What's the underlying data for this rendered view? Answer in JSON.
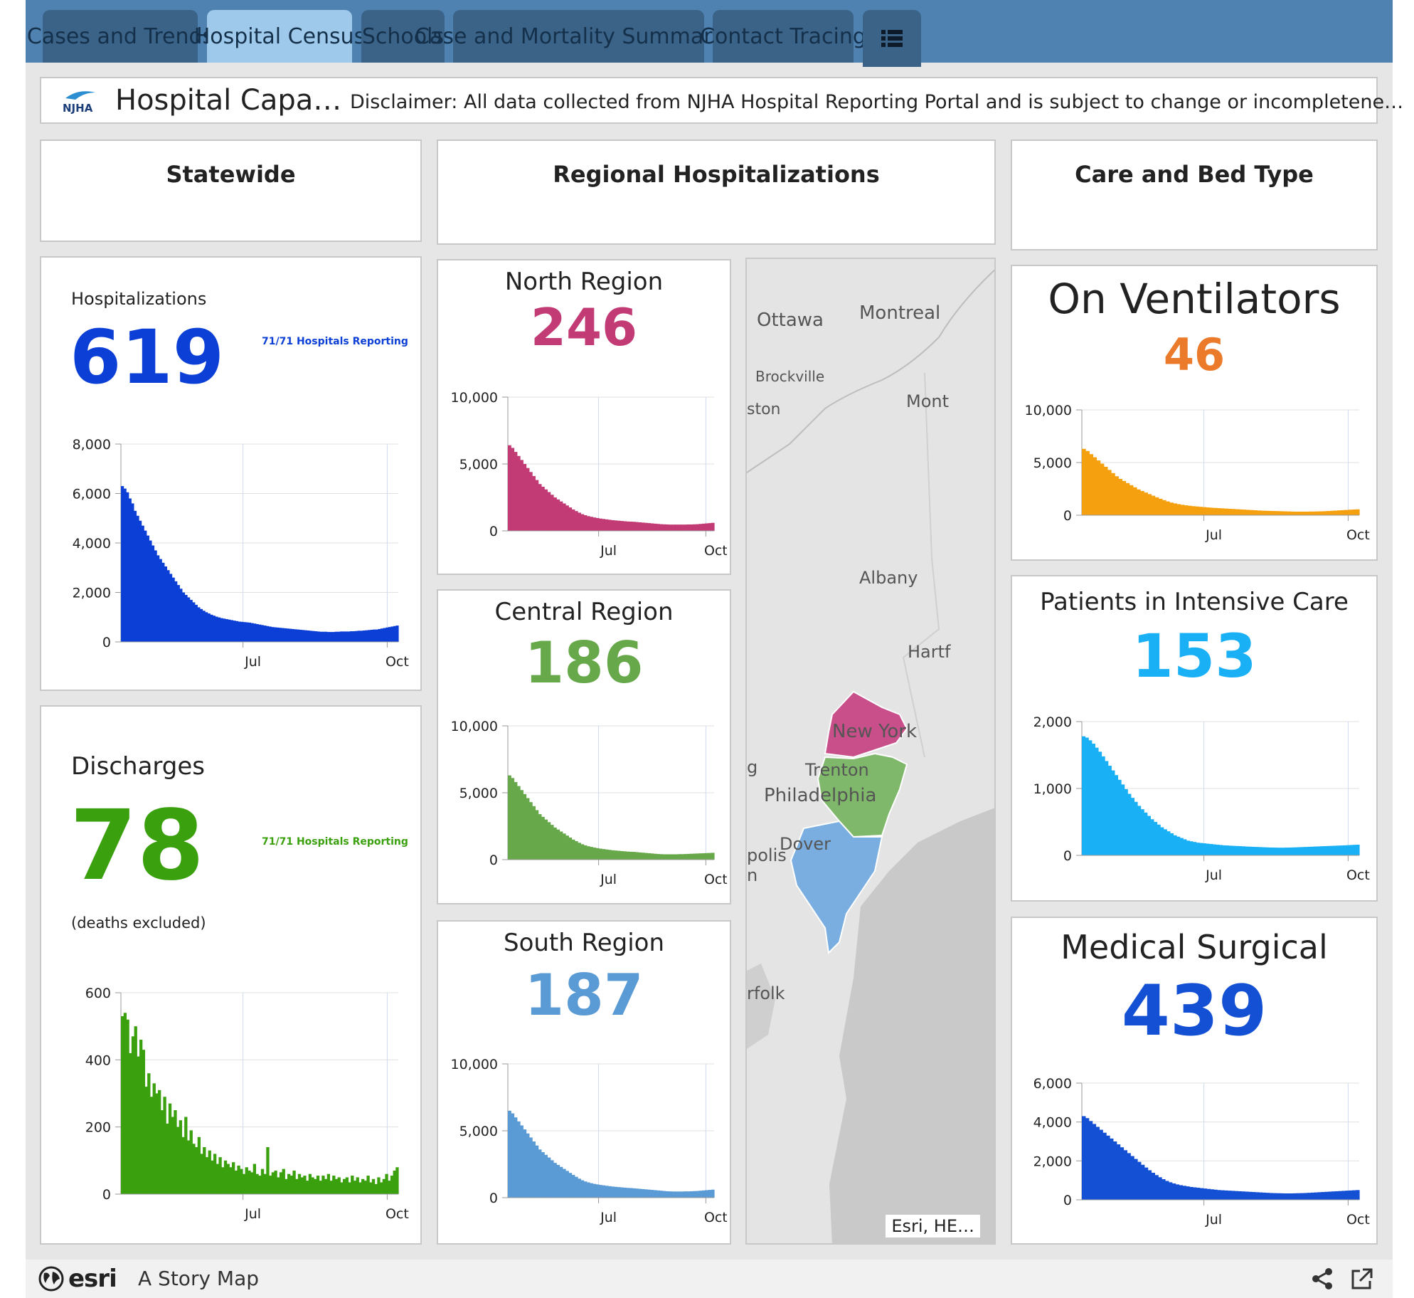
{
  "tabs": [
    {
      "label": "Cases and Trends",
      "active": false
    },
    {
      "label": "Hospital Census",
      "active": true
    },
    {
      "label": "Schools",
      "active": false
    },
    {
      "label": "Case and Mortality Summaries",
      "active": false
    },
    {
      "label": "Contact Tracing",
      "active": false
    }
  ],
  "menu_icon": "list-icon",
  "header": {
    "logo": "NJHA",
    "logo_icon": "njha-logo",
    "title": "Hospital Capa…",
    "disclaimer": "Disclaimer: All data collected from NJHA Hospital Reporting Portal and is subject to change or incompletene…"
  },
  "sections": {
    "statewide": "Statewide",
    "regional": "Regional Hospitalizations",
    "care": "Care and Bed Type"
  },
  "hospitalizations": {
    "label": "Hospitalizations",
    "value": "619",
    "reporting": "71/71 Hospitals Reporting",
    "color": "#0b3fd6"
  },
  "discharges": {
    "label": "Discharges",
    "value": "78",
    "note": "(deaths excluded)",
    "reporting": "71/71 Hospitals Reporting",
    "color": "#3aa00e"
  },
  "regions": [
    {
      "name": "North Region",
      "value": "246",
      "color": "#c23b75"
    },
    {
      "name": "Central Region",
      "value": "186",
      "color": "#66a84a"
    },
    {
      "name": "South Region",
      "value": "187",
      "color": "#5b9bd5"
    }
  ],
  "care": [
    {
      "name": "On Ventilators",
      "value": "46",
      "color": "#f5a00f",
      "numcolor": "#eb7a2a"
    },
    {
      "name": "Patients in Intensive Care",
      "value": "153",
      "color": "#1ab0f5",
      "numcolor": "#1ab0f5"
    },
    {
      "name": "Medical Surgical",
      "value": "439",
      "color": "#1450d4",
      "numcolor": "#1450d4"
    }
  ],
  "map": {
    "labels": [
      "Ottawa",
      "Montreal",
      "Brockville",
      "ston",
      "Mont",
      "Albany",
      "Hartf",
      "New York",
      "Trenton",
      "Philadelphia",
      "Dover",
      "g",
      "polis",
      "n",
      "rfolk"
    ],
    "attribution": "Esri, HE…"
  },
  "footer": {
    "brand": "esri",
    "brand_icon": "globe-icon",
    "story": "A Story Map",
    "share_icon": "share-icon",
    "open_icon": "external-link-icon"
  },
  "chart_data": [
    {
      "id": "hosp",
      "type": "bar",
      "x_ticks": [
        "Jul",
        "Oct"
      ],
      "y_ticks": [
        "0",
        "2,000",
        "4,000",
        "6,000",
        "8,000"
      ],
      "ylim": [
        0,
        8000
      ],
      "series": [
        {
          "values": [
            6300,
            6200,
            6050,
            5800,
            5600,
            5300,
            5100,
            4900,
            4700,
            4500,
            4300,
            4100,
            3900,
            3700,
            3500,
            3350,
            3200,
            3050,
            2900,
            2750,
            2600,
            2450,
            2300,
            2150,
            2000,
            1900,
            1800,
            1700,
            1600,
            1500,
            1400,
            1330,
            1260,
            1200,
            1150,
            1100,
            1060,
            1020,
            990,
            960,
            940,
            920,
            900,
            880,
            860,
            840,
            820,
            810,
            800,
            790,
            780,
            760,
            740,
            720,
            700,
            680,
            660,
            640,
            620,
            600,
            590,
            580,
            570,
            560,
            550,
            540,
            530,
            520,
            510,
            500,
            490,
            480,
            470,
            460,
            450,
            440,
            430,
            420,
            410,
            410,
            410,
            400,
            400,
            400,
            410,
            410,
            420,
            420,
            420,
            420,
            430,
            430,
            440,
            450,
            450,
            460,
            470,
            480,
            490,
            500,
            500,
            520,
            540,
            560,
            580,
            600,
            620,
            640,
            660
          ]
        }
      ]
    },
    {
      "id": "disch",
      "type": "bar",
      "x_ticks": [
        "Jul",
        "Oct"
      ],
      "y_ticks": [
        "0",
        "200",
        "400",
        "600"
      ],
      "ylim": [
        0,
        600
      ],
      "series": [
        {
          "values": [
            530,
            540,
            520,
            420,
            470,
            500,
            410,
            460,
            430,
            320,
            360,
            290,
            330,
            300,
            310,
            250,
            290,
            210,
            270,
            230,
            250,
            200,
            220,
            170,
            230,
            160,
            190,
            150,
            140,
            170,
            120,
            140,
            110,
            130,
            100,
            120,
            90,
            110,
            80,
            100,
            90,
            80,
            95,
            70,
            85,
            75,
            60,
            80,
            70,
            65,
            90,
            60,
            55,
            75,
            60,
            140,
            55,
            65,
            70,
            50,
            65,
            75,
            45,
            60,
            55,
            70,
            45,
            60,
            50,
            55,
            40,
            60,
            50,
            45,
            55,
            40,
            55,
            45,
            60,
            40,
            55,
            45,
            50,
            35,
            45,
            50,
            35,
            55,
            40,
            50,
            35,
            45,
            40,
            55,
            35,
            45,
            30,
            50,
            35,
            45,
            60,
            40,
            55,
            70,
            80
          ]
        }
      ]
    },
    {
      "id": "north",
      "type": "bar",
      "x_ticks": [
        "Jul",
        "Oct"
      ],
      "y_ticks": [
        "0",
        "5,000",
        "10,000"
      ],
      "ylim": [
        0,
        10000
      ],
      "series": [
        {
          "values": [
            6400,
            6200,
            5900,
            5600,
            5300,
            5000,
            4700,
            4400,
            4100,
            3800,
            3500,
            3300,
            3100,
            2900,
            2700,
            2500,
            2350,
            2200,
            2050,
            1900,
            1750,
            1600,
            1480,
            1360,
            1250,
            1170,
            1100,
            1050,
            1000,
            960,
            920,
            890,
            860,
            830,
            800,
            780,
            760,
            740,
            720,
            700,
            690,
            680,
            660,
            640,
            620,
            600,
            580,
            560,
            540,
            520,
            500,
            490,
            480,
            470,
            470,
            470,
            470,
            470,
            470,
            480,
            480,
            490,
            500,
            520,
            540,
            560,
            580,
            600
          ]
        }
      ]
    },
    {
      "id": "central",
      "type": "bar",
      "x_ticks": [
        "Jul",
        "Oct"
      ],
      "y_ticks": [
        "0",
        "5,000",
        "10,000"
      ],
      "ylim": [
        0,
        10000
      ],
      "series": [
        {
          "values": [
            6300,
            6100,
            5800,
            5500,
            5200,
            4900,
            4600,
            4300,
            4000,
            3700,
            3400,
            3200,
            3000,
            2800,
            2600,
            2400,
            2250,
            2100,
            1950,
            1800,
            1650,
            1500,
            1380,
            1260,
            1150,
            1070,
            1000,
            950,
            900,
            860,
            820,
            790,
            760,
            730,
            700,
            680,
            660,
            640,
            620,
            600,
            590,
            580,
            560,
            540,
            520,
            500,
            480,
            460,
            440,
            420,
            410,
            400,
            400,
            400,
            400,
            400,
            410,
            410,
            420,
            430,
            440,
            450,
            460,
            470,
            480,
            490,
            500,
            510
          ]
        }
      ]
    },
    {
      "id": "south",
      "type": "bar",
      "x_ticks": [
        "Jul",
        "Oct"
      ],
      "y_ticks": [
        "0",
        "5,000",
        "10,000"
      ],
      "ylim": [
        0,
        10000
      ],
      "series": [
        {
          "values": [
            6500,
            6300,
            6000,
            5700,
            5400,
            5100,
            4800,
            4500,
            4200,
            3900,
            3600,
            3400,
            3200,
            3000,
            2800,
            2600,
            2450,
            2300,
            2150,
            2000,
            1850,
            1700,
            1560,
            1420,
            1300,
            1210,
            1140,
            1080,
            1030,
            990,
            950,
            920,
            890,
            860,
            830,
            810,
            790,
            770,
            750,
            730,
            720,
            700,
            680,
            660,
            640,
            620,
            600,
            580,
            560,
            540,
            520,
            500,
            480,
            470,
            460,
            460,
            460,
            460,
            470,
            470,
            480,
            490,
            500,
            520,
            540,
            560,
            580,
            600
          ]
        }
      ]
    },
    {
      "id": "vent",
      "type": "bar",
      "x_ticks": [
        "Jul",
        "Oct"
      ],
      "y_ticks": [
        "0",
        "5,000",
        "10,000"
      ],
      "ylim": [
        0,
        10000
      ],
      "series": [
        {
          "values": [
            6300,
            6100,
            5800,
            5500,
            5200,
            4900,
            4600,
            4300,
            4000,
            3700,
            3450,
            3250,
            3050,
            2850,
            2650,
            2450,
            2300,
            2150,
            2000,
            1850,
            1700,
            1560,
            1430,
            1310,
            1200,
            1120,
            1050,
            990,
            940,
            900,
            860,
            830,
            800,
            770,
            740,
            710,
            690,
            670,
            650,
            630,
            610,
            590,
            570,
            550,
            530,
            510,
            490,
            470,
            450,
            430,
            420,
            410,
            400,
            390,
            380,
            370,
            360,
            350,
            340,
            340,
            340,
            340,
            350,
            350,
            360,
            370,
            380,
            400,
            420,
            440,
            460,
            480,
            500,
            520,
            540,
            560
          ]
        }
      ]
    },
    {
      "id": "icu",
      "type": "bar",
      "x_ticks": [
        "Jul",
        "Oct"
      ],
      "y_ticks": [
        "0",
        "1,000",
        "2,000"
      ],
      "ylim": [
        0,
        2000
      ],
      "series": [
        {
          "values": [
            1780,
            1760,
            1720,
            1670,
            1610,
            1550,
            1480,
            1410,
            1340,
            1270,
            1200,
            1130,
            1060,
            990,
            920,
            860,
            800,
            740,
            690,
            640,
            590,
            540,
            500,
            460,
            420,
            390,
            360,
            330,
            300,
            280,
            260,
            240,
            220,
            210,
            200,
            190,
            185,
            180,
            175,
            170,
            165,
            160,
            155,
            150,
            148,
            145,
            142,
            140,
            138,
            135,
            132,
            130,
            128,
            126,
            124,
            122,
            120,
            118,
            117,
            116,
            115,
            115,
            116,
            117,
            118,
            120,
            122,
            124,
            126,
            128,
            130,
            132,
            134,
            136,
            138,
            140,
            142,
            144,
            146,
            148,
            150,
            152,
            155,
            158,
            160
          ]
        }
      ]
    },
    {
      "id": "medsurg",
      "type": "bar",
      "x_ticks": [
        "Jul",
        "Oct"
      ],
      "y_ticks": [
        "0",
        "2,000",
        "4,000",
        "6,000"
      ],
      "ylim": [
        0,
        6000
      ],
      "series": [
        {
          "values": [
            4300,
            4200,
            4050,
            3900,
            3750,
            3600,
            3450,
            3300,
            3150,
            3000,
            2850,
            2700,
            2550,
            2400,
            2250,
            2100,
            1950,
            1800,
            1660,
            1520,
            1390,
            1270,
            1160,
            1060,
            970,
            900,
            840,
            790,
            750,
            720,
            690,
            660,
            640,
            620,
            600,
            580,
            560,
            540,
            520,
            500,
            490,
            480,
            470,
            460,
            450,
            440,
            430,
            420,
            410,
            400,
            390,
            380,
            370,
            360,
            350,
            345,
            340,
            335,
            330,
            330,
            330,
            335,
            340,
            345,
            350,
            360,
            370,
            380,
            390,
            400,
            410,
            420,
            430,
            440,
            450,
            460,
            470,
            480,
            490,
            500
          ]
        }
      ]
    }
  ]
}
